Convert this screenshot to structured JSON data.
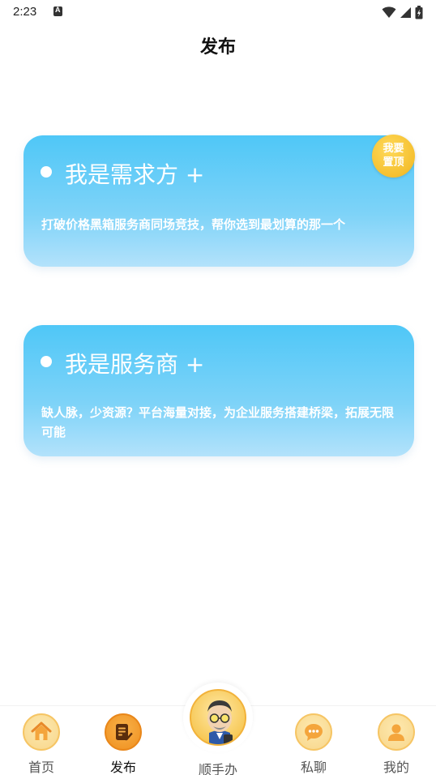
{
  "status_bar": {
    "time": "2:23"
  },
  "header": {
    "title": "发布"
  },
  "cards": [
    {
      "title": "我是需求方 +",
      "description": "打破价格黑箱服务商同场竞技，帮你选到最划算的那一个"
    },
    {
      "title": "我是服务商 +",
      "description": "缺人脉，少资源？平台海量对接，为企业服务搭建桥梁，拓展无限可能"
    }
  ],
  "pin_badge": {
    "line1": "我要",
    "line2": "置顶"
  },
  "tab_bar": {
    "tabs": [
      {
        "label": "首页",
        "icon": "home-icon"
      },
      {
        "label": "发布",
        "icon": "publish-icon",
        "active": true
      },
      {
        "label": "顺手办",
        "icon": "mascot-icon"
      },
      {
        "label": "私聊",
        "icon": "chat-icon"
      },
      {
        "label": "我的",
        "icon": "user-icon"
      }
    ]
  },
  "colors": {
    "card_top": "#4fc7f7",
    "card_bottom": "#b3e2fb",
    "badge": "#f5c030",
    "tab_icon_bg": "#f8d68a"
  }
}
